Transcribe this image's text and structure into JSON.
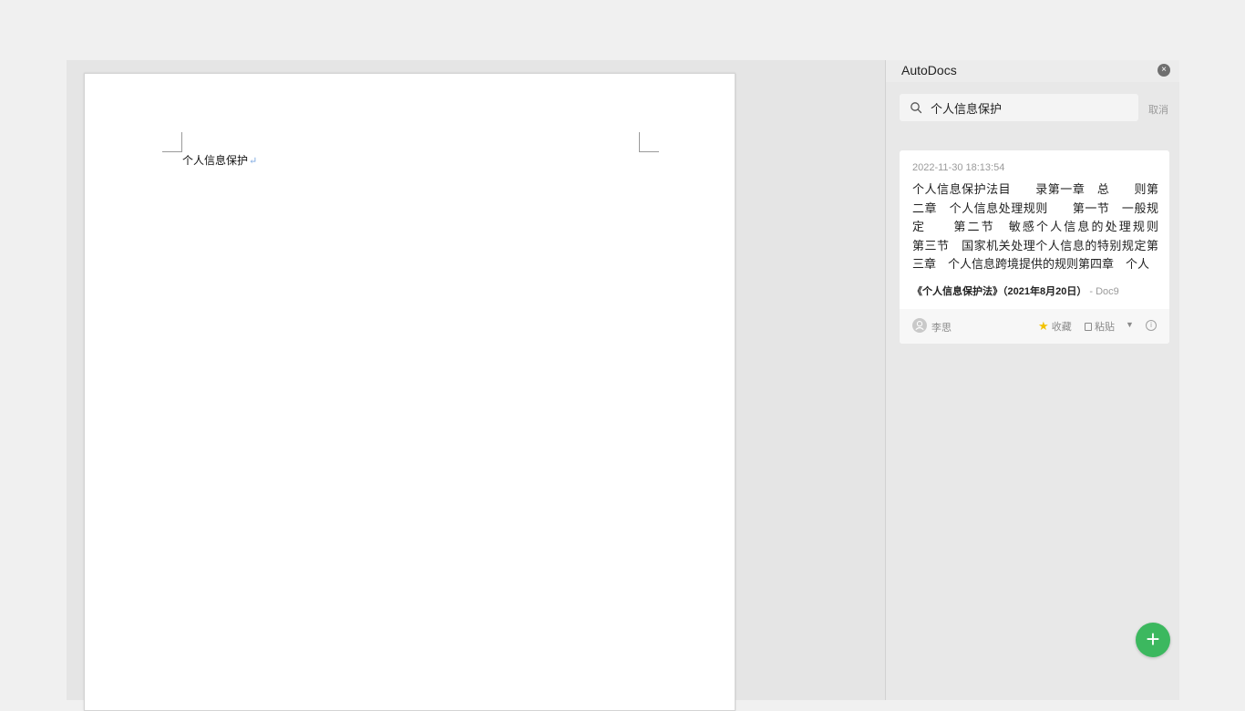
{
  "document": {
    "heading_text": "个人信息保护",
    "paragraph_mark": "↵"
  },
  "panel": {
    "title": "AutoDocs",
    "close_glyph": "×",
    "search": {
      "value": "个人信息保护",
      "icon": "search-icon"
    },
    "cancel_label": "取消",
    "result": {
      "timestamp": "2022-11-30 18:13:54",
      "snippet": "个人信息保护法目　　录第一章　总　　则第二章　个人信息处理规则　　第一节　一般规定　　第二节　敏感个人信息的处理规则　　第三节　国家机关处理个人信息的特别规定第三章　个人信息跨境提供的规则第四章　个人",
      "source_title": "《个人信息保护法》（2021年8月20日）",
      "source_doc": " - Doc9",
      "author": "李思",
      "favorite_label": "收藏",
      "paste_label": "粘贴",
      "caret_glyph": "▼",
      "info_glyph": "i"
    },
    "fab_glyph": "+"
  },
  "colors": {
    "accent_green": "#3cb85f",
    "star_yellow": "#f2c200"
  }
}
